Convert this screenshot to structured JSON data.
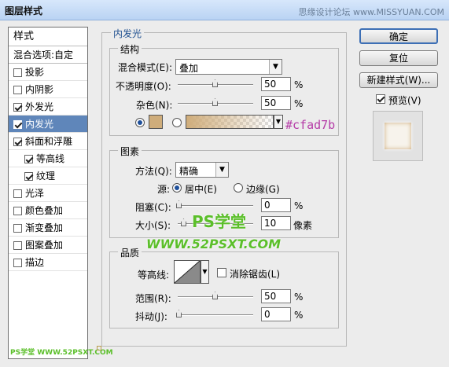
{
  "window": {
    "title": "图层样式",
    "watermark": "思缘设计论坛 www.MISSYUAN.COM"
  },
  "sidebar": {
    "header": "样式",
    "blending": "混合选项:自定",
    "items": [
      {
        "label": "投影",
        "checked": false
      },
      {
        "label": "内阴影",
        "checked": false
      },
      {
        "label": "外发光",
        "checked": true
      },
      {
        "label": "内发光",
        "checked": true,
        "selected": true
      },
      {
        "label": "斜面和浮雕",
        "checked": true
      },
      {
        "label": "等高线",
        "checked": true,
        "sub": true
      },
      {
        "label": "纹理",
        "checked": true,
        "sub": true
      },
      {
        "label": "光泽",
        "checked": false
      },
      {
        "label": "颜色叠加",
        "checked": false
      },
      {
        "label": "渐变叠加",
        "checked": false
      },
      {
        "label": "图案叠加",
        "checked": false
      },
      {
        "label": "描边",
        "checked": false
      }
    ],
    "footer_logo": "PS学堂 WWW.52PSXT.COM"
  },
  "main": {
    "section_title": "内发光",
    "structure": {
      "title": "结构",
      "blend_mode_label": "混合模式(E):",
      "blend_mode_value": "叠加",
      "opacity_label": "不透明度(O):",
      "opacity_value": "50",
      "noise_label": "杂色(N):",
      "noise_value": "50",
      "percent": "%",
      "color_hex_text": "#cfad7b",
      "color": "#cfad7b"
    },
    "elements": {
      "title": "图素",
      "method_label": "方法(Q):",
      "method_value": "精确",
      "source_label": "源:",
      "source_center": "居中(E)",
      "source_edge": "边缘(G)",
      "choke_label": "阻塞(C):",
      "choke_value": "0",
      "size_label": "大小(S):",
      "size_value": "10",
      "size_unit": "像素"
    },
    "quality": {
      "title": "品质",
      "contour_label": "等高线:",
      "antialias_label": "消除锯齿(L)",
      "range_label": "范围(R):",
      "range_value": "50",
      "jitter_label": "抖动(J):",
      "jitter_value": "0"
    },
    "overlay_logo": {
      "line1": "PS学堂",
      "line2": "WWW.52PSXT.COM"
    }
  },
  "buttons": {
    "ok": "确定",
    "reset": "复位",
    "new_style": "新建样式(W)...",
    "preview": "预览(V)"
  }
}
